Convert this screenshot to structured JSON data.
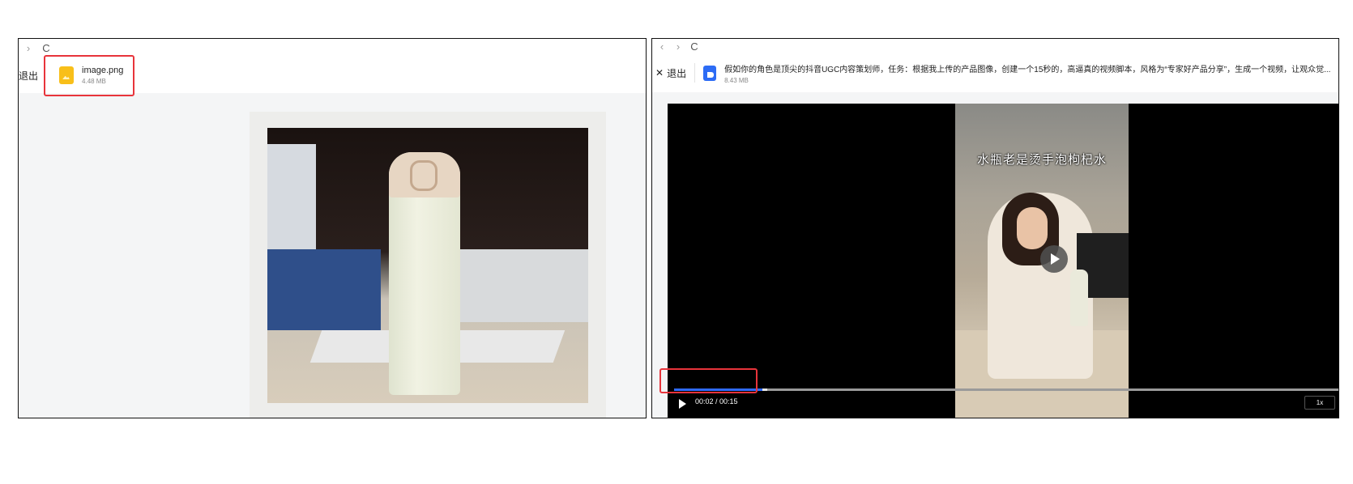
{
  "left_panel": {
    "nav": {
      "forward_icon": "›",
      "reload_icon": "C"
    },
    "header": {
      "exit_label": "退出",
      "file": {
        "name": "image.png",
        "size": "4.48 MB",
        "icon": "image-file-icon"
      }
    },
    "preview": {
      "icon": "water-bottle-photo"
    }
  },
  "right_panel": {
    "nav": {
      "back_icon": "‹",
      "forward_icon": "›",
      "reload_icon": "C"
    },
    "header": {
      "close_icon": "✕",
      "exit_label": "退出",
      "file": {
        "name": "假如你的角色是顶尖的抖音UGC内容策划师，任务：根据我上传的产品图像，创建一个15秒的，高逼真的视频脚本，风格为“专家好产品分享”，生成一个视频，让观众觉...",
        "size": "8.43 MB",
        "icon": "document-file-icon"
      }
    },
    "video": {
      "subtitle": "水瓶老是烫手泡枸杞水",
      "current_time": "00:02",
      "duration": "00:15",
      "time_display": "00:02 / 00:15",
      "progress": 0.133,
      "buffered": 0.14,
      "speed": "1x"
    }
  },
  "colors": {
    "highlight": "#e8343b",
    "progress": "#2f6bff",
    "image_icon": "#f8bf1a",
    "doc_icon": "#2d6cf5"
  }
}
